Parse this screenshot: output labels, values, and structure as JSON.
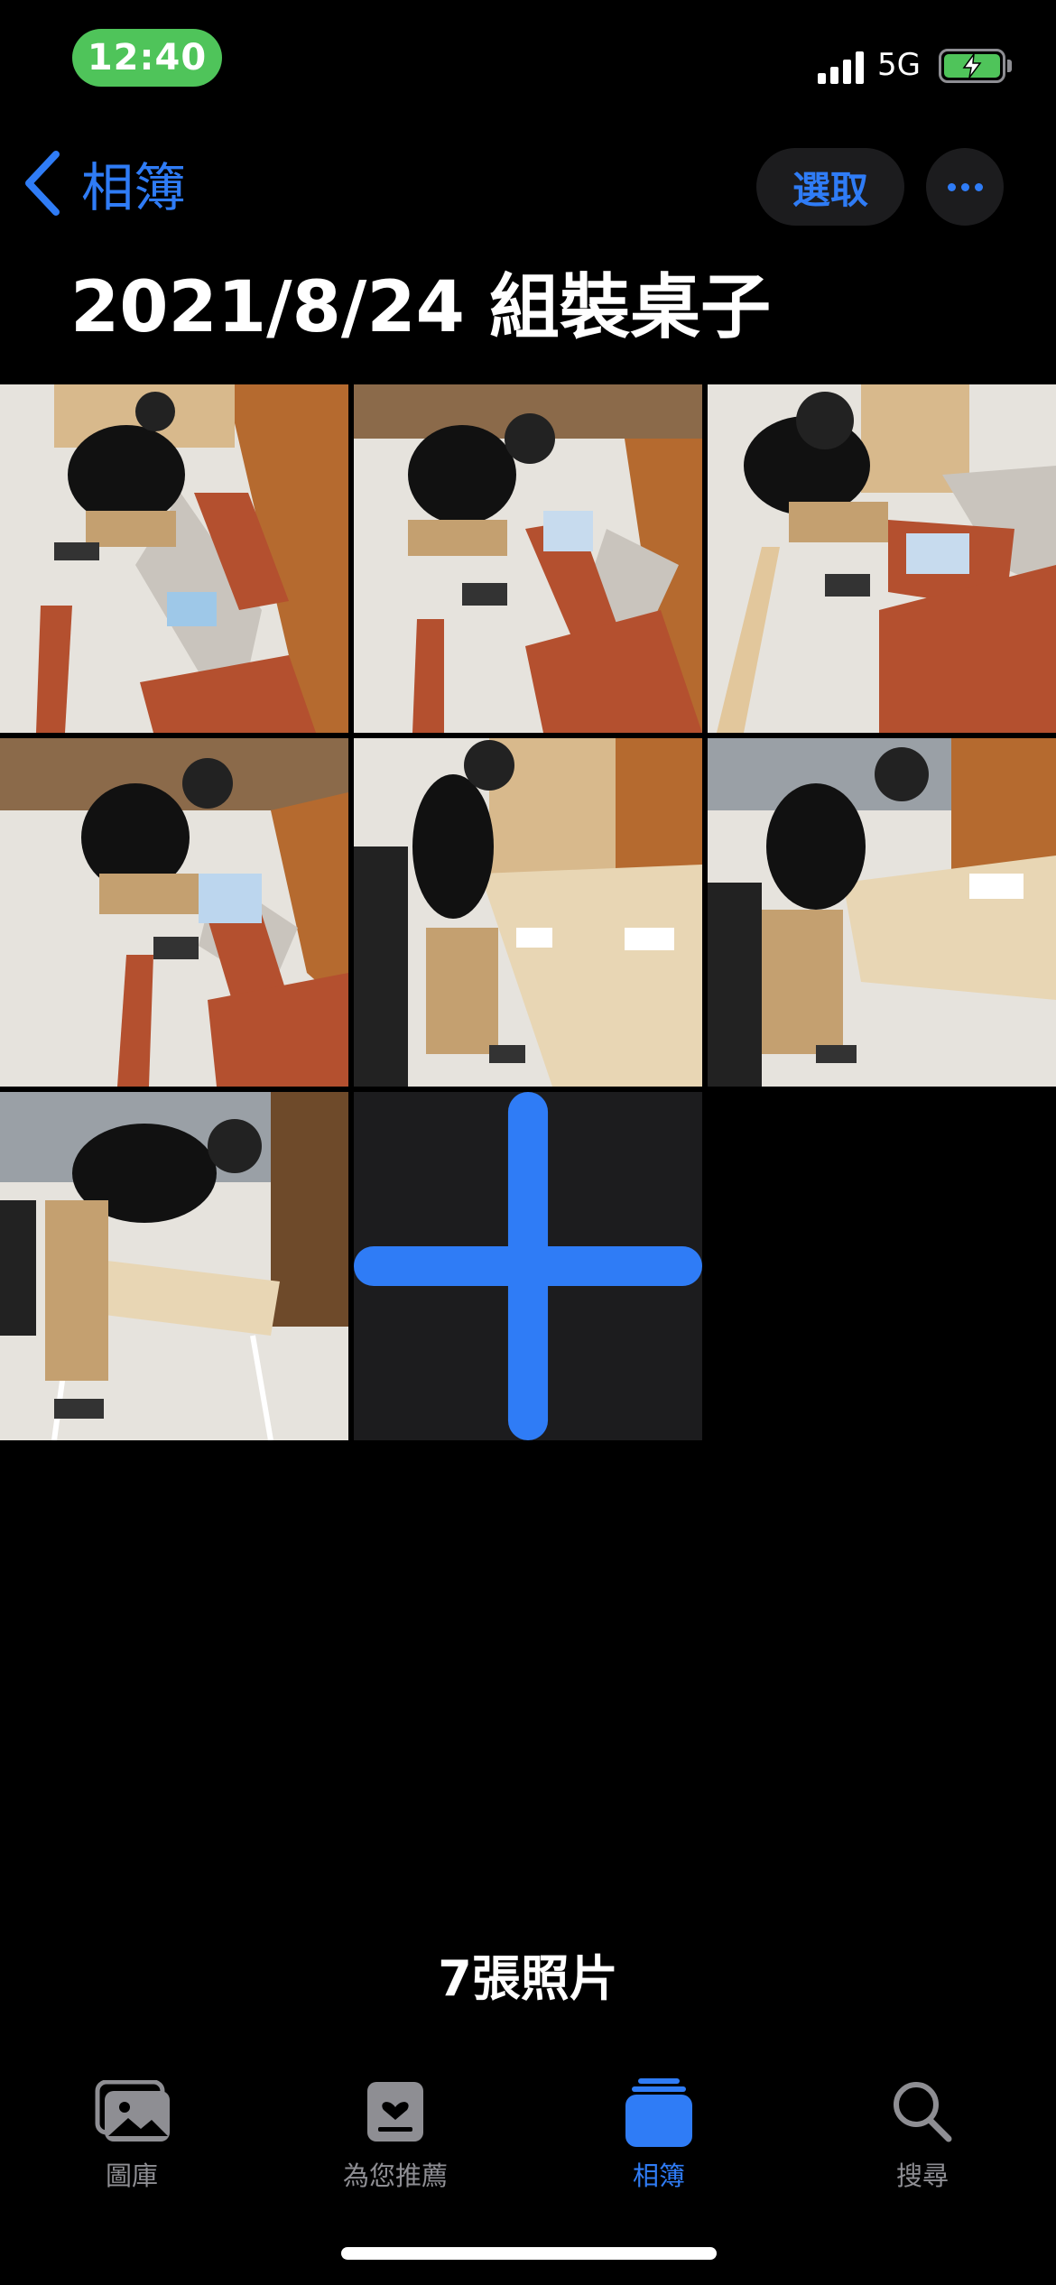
{
  "status_bar": {
    "time": "12:40",
    "network": "5G",
    "battery_color": "#4fc45a"
  },
  "nav": {
    "back_label": "相簿",
    "select_label": "選取"
  },
  "album": {
    "title": "2021/8/24 組裝桌子",
    "photo_count": "7張照片"
  },
  "tabs": [
    {
      "label": "圖庫",
      "icon": "photo-library-icon"
    },
    {
      "label": "為您推薦",
      "icon": "for-you-icon"
    },
    {
      "label": "相簿",
      "icon": "albums-icon",
      "active": true
    },
    {
      "label": "搜尋",
      "icon": "search-icon"
    }
  ],
  "colors": {
    "accent": "#2f7cf6",
    "background": "#000000",
    "surface": "#1c1c1e",
    "inactive": "#8e8e93"
  }
}
